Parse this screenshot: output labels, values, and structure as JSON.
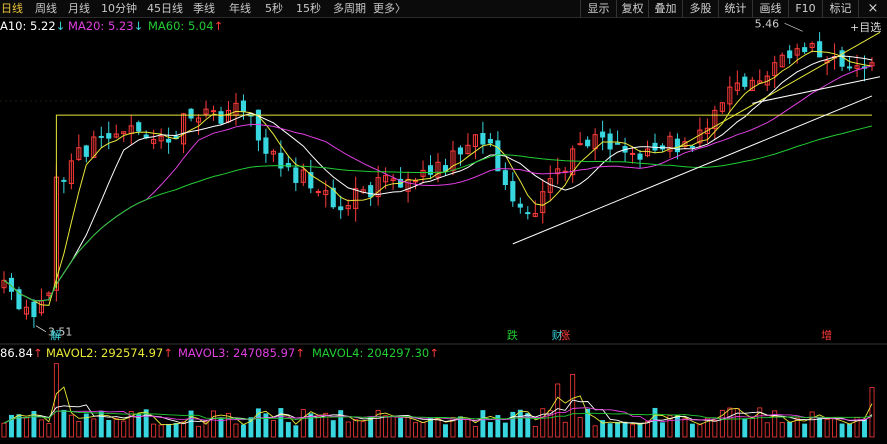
{
  "colors": {
    "background": "#000000",
    "rise": "#ff3b3b",
    "fall": "#38d7e0",
    "ma10": "#ffffff",
    "ma20": "#e040e0",
    "ma60": "#22cc33",
    "mavol2": "#e8e83a",
    "mavol3": "#e040e0",
    "mavol4": "#22cc33",
    "accent": "#e8c23a"
  },
  "toolbar": {
    "periods": [
      {
        "label": "日线",
        "active": true
      },
      {
        "label": "周线"
      },
      {
        "label": "月线"
      },
      {
        "label": "10分钟"
      },
      {
        "label": "45日线"
      },
      {
        "label": "季线"
      },
      {
        "label": "年线"
      },
      {
        "label": "5秒"
      },
      {
        "label": "15秒"
      },
      {
        "label": "多周期"
      },
      {
        "label": "更多"
      }
    ],
    "more_arrow": "〉",
    "buttons": [
      "显示",
      "复权",
      "叠加",
      "多股",
      "统计",
      "画线",
      "F10",
      "标记"
    ],
    "close_icon": "×"
  },
  "legend_top": {
    "ma10": {
      "label": "A10: 5.22",
      "arrow": "↓"
    },
    "ma20": {
      "label": "MA20: 5.23",
      "arrow": "↓"
    },
    "ma60": {
      "label": "MA60: 5.04",
      "arrow": "↑"
    },
    "right_label": "+目选"
  },
  "legend_vol": {
    "mavol1": {
      "label": "86.84",
      "arrow": "↑"
    },
    "mavol2": {
      "label": "MAVOL2: 292574.97",
      "arrow": "↑"
    },
    "mavol3": {
      "label": "MAVOL3: 247085.97",
      "arrow": "↑"
    },
    "mavol4": {
      "label": "MAVOL4: 204297.30",
      "arrow": "↑"
    }
  },
  "annotations": {
    "high_label": "5.46",
    "low_label": "3.51"
  },
  "markers": [
    {
      "label": "解",
      "bar": 7,
      "color": "#38d7e0"
    },
    {
      "label": "跌",
      "bar": 68,
      "color": "#22cc33"
    },
    {
      "label": "财",
      "bar": 74,
      "color": "#38d7e0"
    },
    {
      "label": "涨",
      "bar": 75,
      "color": "#ff3b3b"
    },
    {
      "label": "增",
      "bar": 110,
      "color": "#ff3b3b"
    }
  ],
  "chart_data": {
    "type": "candlestick",
    "bar_count": 117,
    "price_range": [
      3.4,
      5.55
    ],
    "period_high": 5.46,
    "period_low": 3.51,
    "ma_latest": {
      "MA10": 5.22,
      "MA20": 5.23,
      "MA60": 5.04
    },
    "mavol_latest": {
      "MAVOL2": 292574.97,
      "MAVOL3": 247085.97,
      "MAVOL4": 204297.3
    },
    "price_anchors": [
      [
        0,
        3.75
      ],
      [
        3,
        3.62
      ],
      [
        4,
        3.55
      ],
      [
        6,
        3.7
      ],
      [
        7,
        4.45
      ],
      [
        9,
        4.6
      ],
      [
        12,
        4.75
      ],
      [
        15,
        4.8
      ],
      [
        18,
        4.85
      ],
      [
        22,
        4.72
      ],
      [
        25,
        4.95
      ],
      [
        28,
        4.9
      ],
      [
        30,
        4.95
      ],
      [
        32,
        5.0
      ],
      [
        35,
        4.7
      ],
      [
        38,
        4.55
      ],
      [
        42,
        4.45
      ],
      [
        44,
        4.3
      ],
      [
        46,
        4.35
      ],
      [
        50,
        4.45
      ],
      [
        54,
        4.5
      ],
      [
        58,
        4.55
      ],
      [
        61,
        4.7
      ],
      [
        64,
        4.75
      ],
      [
        66,
        4.6
      ],
      [
        68,
        4.3
      ],
      [
        70,
        4.25
      ],
      [
        72,
        4.35
      ],
      [
        74,
        4.55
      ],
      [
        77,
        4.7
      ],
      [
        80,
        4.75
      ],
      [
        83,
        4.7
      ],
      [
        86,
        4.65
      ],
      [
        89,
        4.72
      ],
      [
        92,
        4.75
      ],
      [
        95,
        4.95
      ],
      [
        99,
        5.15
      ],
      [
        102,
        5.22
      ],
      [
        105,
        5.35
      ],
      [
        107,
        5.4
      ],
      [
        110,
        5.3
      ],
      [
        113,
        5.28
      ],
      [
        116,
        5.25
      ]
    ],
    "volume_spikes": [
      [
        7,
        3.2
      ],
      [
        25,
        1.8
      ],
      [
        68,
        1.6
      ],
      [
        74,
        4.2
      ],
      [
        76,
        2.2
      ],
      [
        116,
        2.5
      ]
    ]
  }
}
